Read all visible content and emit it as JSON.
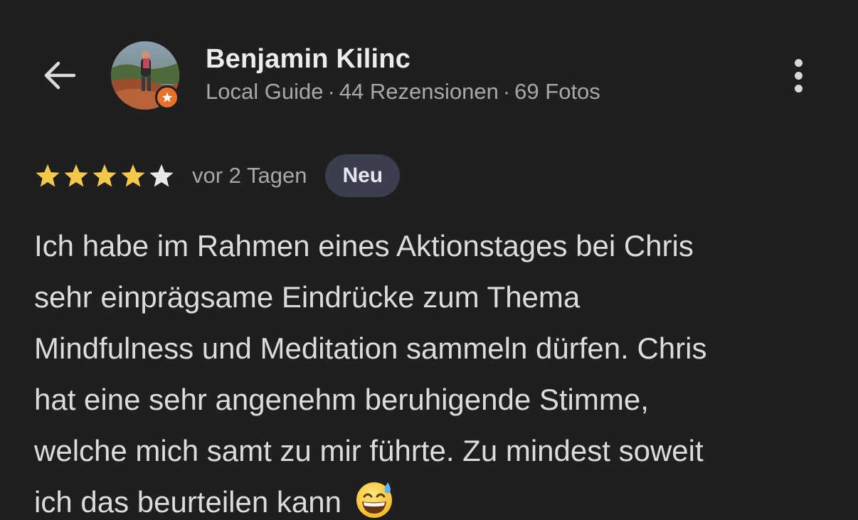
{
  "header": {
    "back_icon": "arrow-left-icon",
    "more_icon": "more-vertical-icon",
    "user": {
      "name": "Benjamin Kilinc",
      "guide_label": "Local Guide",
      "reviews_count": "44 Rezensionen",
      "photos_count": "69 Fotos",
      "separator": "·",
      "badge_icon": "local-guide-star-icon"
    }
  },
  "review": {
    "rating": 4,
    "max_rating": 5,
    "time": "vor 2 Tagen",
    "badge": "Neu",
    "text_lines": [
      "Ich habe im Rahmen eines Aktionstages bei Chris",
      "sehr einprägsame Eindrücke zum Thema",
      "Mindfulness und Meditation sammeln dürfen. Chris",
      "hat eine sehr angenehm beruhigende Stimme,",
      "welche mich samt zu mir führte. Zu mindest soweit",
      "ich das beurteilen kann"
    ],
    "trailing_emoji": "sweat-smile-emoji"
  },
  "colors": {
    "background": "#1f1f1f",
    "star_filled": "#f4c84a",
    "star_empty": "#e8e8e8",
    "guide_badge": "#e8702a",
    "new_badge_bg": "#3b3e4c"
  }
}
